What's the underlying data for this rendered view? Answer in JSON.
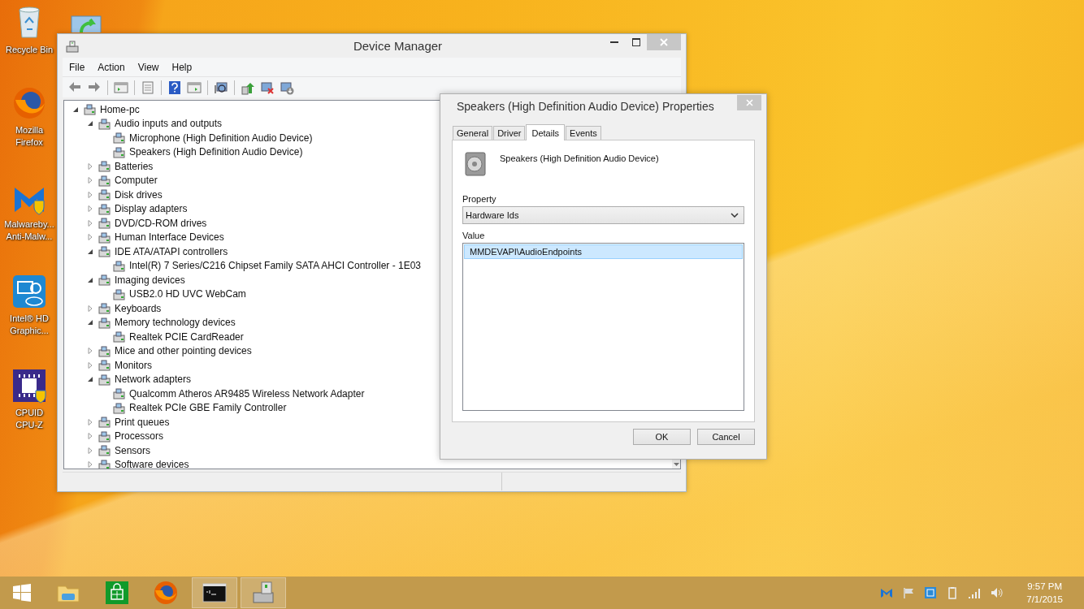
{
  "desktop_icons": [
    {
      "kind": "recycle-bin",
      "label_lines": [
        "Recycle Bin"
      ]
    },
    {
      "kind": "firefox",
      "label_lines": [
        "Mozilla",
        "Firefox"
      ]
    },
    {
      "kind": "malwarebytes",
      "label_lines": [
        "Malwareby...",
        "Anti-Malw..."
      ]
    },
    {
      "kind": "intel",
      "label_lines": [
        "Intel® HD",
        "Graphic..."
      ]
    },
    {
      "kind": "cpuid",
      "label_lines": [
        "CPUID",
        "CPU-Z"
      ]
    }
  ],
  "device_manager": {
    "title": "Device Manager",
    "menu": [
      "File",
      "Action",
      "View",
      "Help"
    ],
    "tree": [
      {
        "label": "Home-pc",
        "expanded": true,
        "children": [
          {
            "label": "Audio inputs and outputs",
            "expanded": true,
            "children": [
              {
                "label": "Microphone (High Definition Audio Device)"
              },
              {
                "label": "Speakers (High Definition Audio Device)"
              }
            ]
          },
          {
            "label": "Batteries",
            "expanded": false
          },
          {
            "label": "Computer",
            "expanded": false
          },
          {
            "label": "Disk drives",
            "expanded": false
          },
          {
            "label": "Display adapters",
            "expanded": false
          },
          {
            "label": "DVD/CD-ROM drives",
            "expanded": false
          },
          {
            "label": "Human Interface Devices",
            "expanded": false
          },
          {
            "label": "IDE ATA/ATAPI controllers",
            "expanded": true,
            "children": [
              {
                "label": "Intel(R) 7 Series/C216 Chipset Family SATA AHCI Controller - 1E03"
              }
            ]
          },
          {
            "label": "Imaging devices",
            "expanded": true,
            "children": [
              {
                "label": "USB2.0 HD UVC WebCam"
              }
            ]
          },
          {
            "label": "Keyboards",
            "expanded": false
          },
          {
            "label": "Memory technology devices",
            "expanded": true,
            "children": [
              {
                "label": "Realtek PCIE CardReader"
              }
            ]
          },
          {
            "label": "Mice and other pointing devices",
            "expanded": false
          },
          {
            "label": "Monitors",
            "expanded": false
          },
          {
            "label": "Network adapters",
            "expanded": true,
            "children": [
              {
                "label": "Qualcomm Atheros AR9485 Wireless Network Adapter"
              },
              {
                "label": "Realtek PCIe GBE Family Controller"
              }
            ]
          },
          {
            "label": "Print queues",
            "expanded": false
          },
          {
            "label": "Processors",
            "expanded": false
          },
          {
            "label": "Sensors",
            "expanded": false
          },
          {
            "label": "Software devices",
            "expanded": false
          }
        ]
      }
    ]
  },
  "properties_dialog": {
    "title": "Speakers (High Definition Audio Device) Properties",
    "tabs": [
      {
        "label": "General",
        "selected": false
      },
      {
        "label": "Driver",
        "selected": false
      },
      {
        "label": "Details",
        "selected": true
      },
      {
        "label": "Events",
        "selected": false
      }
    ],
    "device_name": "Speakers (High Definition Audio Device)",
    "property_label": "Property",
    "property_value": "Hardware Ids",
    "value_label": "Value",
    "values": [
      {
        "text": "MMDEVAPI\\AudioEndpoints",
        "selected": true
      }
    ],
    "buttons": [
      "OK",
      "Cancel"
    ]
  },
  "taskbar": {
    "apps": [
      {
        "kind": "explorer",
        "running": false
      },
      {
        "kind": "store",
        "running": false
      },
      {
        "kind": "firefox",
        "running": false
      },
      {
        "kind": "command-prompt",
        "running": true
      },
      {
        "kind": "device-manager",
        "running": true
      }
    ],
    "time": "9:57 PM",
    "date": "7/1/2015"
  }
}
